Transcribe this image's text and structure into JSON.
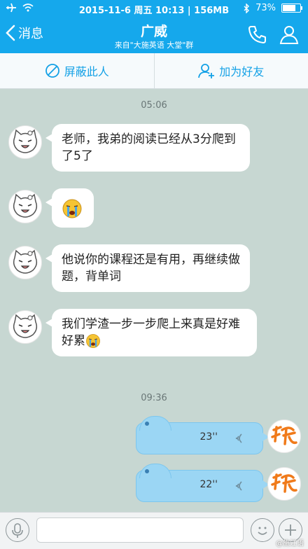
{
  "status_bar": {
    "center": "2015-11-6 周五 10:13 | 156MB",
    "battery": "73%"
  },
  "nav": {
    "back_label": "消息",
    "title": "广威",
    "subtitle": "来自\"大施英语 大堂\"群"
  },
  "actions": {
    "block_label": "屏蔽此人",
    "add_friend_label": "加为好友"
  },
  "messages": {
    "time_1": "05:06",
    "m1": "老师，我弟的阅读已经从3分爬到了5了",
    "m3": "他说你的课程还是有用，再继续做题，背单词",
    "m4": "我们学渣一步一步爬上来真是好难好累",
    "time_2": "09:36",
    "voice_1": "23''",
    "voice_2": "22''"
  },
  "input": {
    "placeholder": ""
  },
  "watermark": "@施江语",
  "colors": {
    "header": "#15a8ec",
    "chat_bg": "#c7d7d2",
    "voice_bubble": "#9bd6f4",
    "accent": "#14a1e6"
  }
}
